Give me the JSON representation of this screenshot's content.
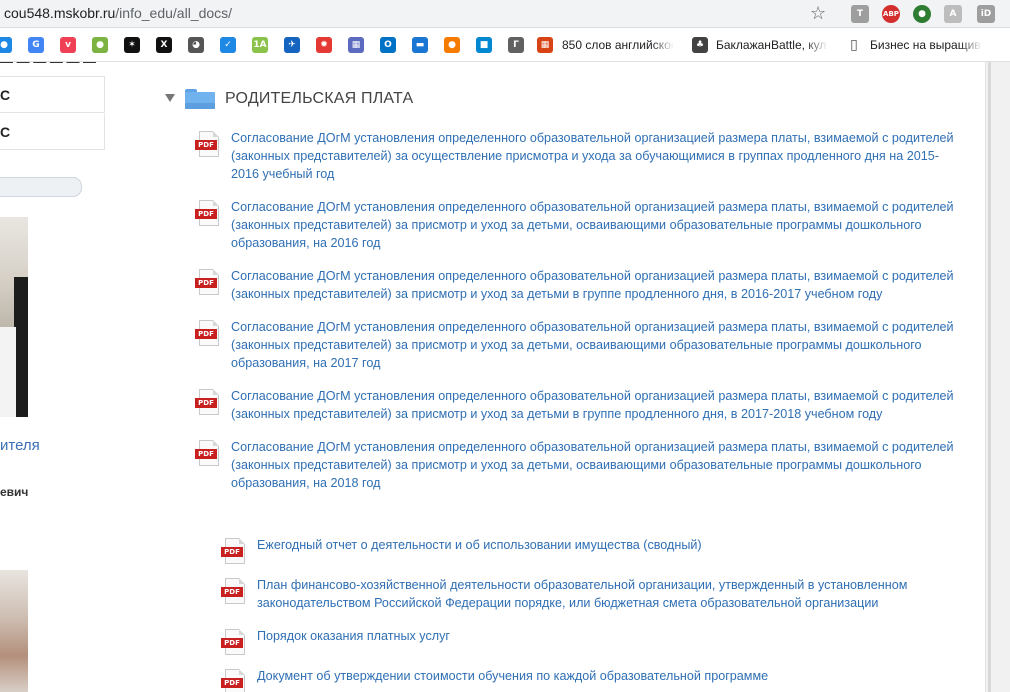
{
  "browser": {
    "url_domain": "cou548.mskobr.ru",
    "url_path": "/info_edu/all_docs/",
    "extensions": [
      {
        "name": "t-icon",
        "glyph": "T",
        "color": "#9e9e9e"
      },
      {
        "name": "adblock-icon",
        "glyph": "ABP",
        "color": "#d32f2f"
      },
      {
        "name": "globe-icon",
        "glyph": "●",
        "color": "#2e7d32"
      },
      {
        "name": "acrobat-icon",
        "glyph": "A",
        "color": "#bdbdbd"
      },
      {
        "name": "id-icon",
        "glyph": "iD",
        "color": "#9e9e9e"
      }
    ]
  },
  "bookmarks": {
    "icons": [
      {
        "name": "bookmark-icon-1",
        "glyph": "●",
        "color": "#1e88e5"
      },
      {
        "name": "translate-icon",
        "glyph": "G",
        "color": "#4285f4"
      },
      {
        "name": "pocket-icon",
        "glyph": "v",
        "color": "#ef4056"
      },
      {
        "name": "ball-icon",
        "glyph": "●",
        "color": "#7cb342"
      },
      {
        "name": "bookmark-icon-5",
        "glyph": "✶",
        "color": "#111111"
      },
      {
        "name": "x-icon",
        "glyph": "X",
        "color": "#111111"
      },
      {
        "name": "panda-icon",
        "glyph": "◕",
        "color": "#555555"
      },
      {
        "name": "bookmark-icon-8",
        "glyph": "✓",
        "color": "#1e88e5"
      },
      {
        "name": "1a-icon",
        "glyph": "1A",
        "color": "#8bc34a"
      },
      {
        "name": "bird-icon",
        "glyph": "✈",
        "color": "#1565c0"
      },
      {
        "name": "star-multicolor-icon",
        "glyph": "✹",
        "color": "#e53935"
      },
      {
        "name": "building-icon",
        "glyph": "▦",
        "color": "#5c6bc0"
      },
      {
        "name": "outlook-icon",
        "glyph": "O",
        "color": "#0072c6"
      },
      {
        "name": "car-icon",
        "glyph": "▬",
        "color": "#1976d2"
      },
      {
        "name": "basketball-icon",
        "glyph": "●",
        "color": "#f57c00"
      },
      {
        "name": "office-icon",
        "glyph": "■",
        "color": "#0288d1"
      },
      {
        "name": "g-icon",
        "glyph": "Г",
        "color": "#616161"
      }
    ],
    "links": [
      {
        "name": "bookmark-850-words",
        "text": "850 слов английског"
      },
      {
        "name": "bookmark-baklazhan",
        "text": "БаклажанBattle, кул"
      },
      {
        "name": "bookmark-biznes",
        "text": "Бизнес на выращив"
      }
    ]
  },
  "sidebar": {
    "menu_items": [
      "С",
      "С"
    ],
    "role_text": "ителя",
    "name_text": "евич"
  },
  "section": {
    "title": "РОДИТЕЛЬСКАЯ ПЛАТА",
    "pdf_label": "PDF",
    "docs": [
      {
        "lines": [
          "Согласование ДОгМ установления определенного образовательной организацией размера платы, взимаемой с родителей",
          "(законных представителей) за осуществление присмотра и ухода за обучающимися в группах продленного дня на 2015-",
          "2016 учебный год"
        ]
      },
      {
        "lines": [
          "Согласование ДОгМ установления определенного образовательной организацией размера платы, взимаемой с родителей",
          "(законных представителей) за присмотр и уход за детьми, осваивающими образовательные программы дошкольного",
          "образования, на 2016 год"
        ]
      },
      {
        "lines": [
          "Согласование ДОгМ установления определенного образовательной организацией размера платы, взимаемой с родителей",
          "(законных представителей) за присмотр и уход за детьми в группе продленного дня, в 2016-2017 учебном году"
        ]
      },
      {
        "lines": [
          "Согласование ДОгМ установления определенного образовательной организацией размера платы, взимаемой с родителей",
          "(законных представителей) за присмотр и уход за детьми, осваивающими образовательные программы дошкольного",
          "образования, на 2017 год"
        ]
      },
      {
        "lines": [
          "Согласование ДОгМ установления определенного образовательной организацией размера платы, взимаемой с родителей",
          "(законных представителей) за присмотр и уход за детьми в группе продленного дня, в 2017-2018 учебном году"
        ]
      },
      {
        "lines": [
          "Согласование ДОгМ установления определенного образовательной организацией размера платы, взимаемой с родителей",
          "(законных представителей) за присмотр и уход за детьми, осваивающими образовательные программы дошкольного",
          "образования, на 2018 год"
        ]
      }
    ]
  },
  "other_docs": [
    {
      "lines": [
        "Ежегодный отчет о деятельности и об использовании имущества (сводный)"
      ]
    },
    {
      "lines": [
        "План финансово-хозяйственной деятельности образовательной организации, утвержденный в установленном",
        "законодательством Российской Федерации порядке, или бюджетная смета образовательной организации"
      ]
    },
    {
      "lines": [
        "Порядок оказания платных услуг"
      ]
    },
    {
      "lines": [
        "Документ об утверждении стоимости обучения по каждой образовательной программе"
      ]
    }
  ]
}
